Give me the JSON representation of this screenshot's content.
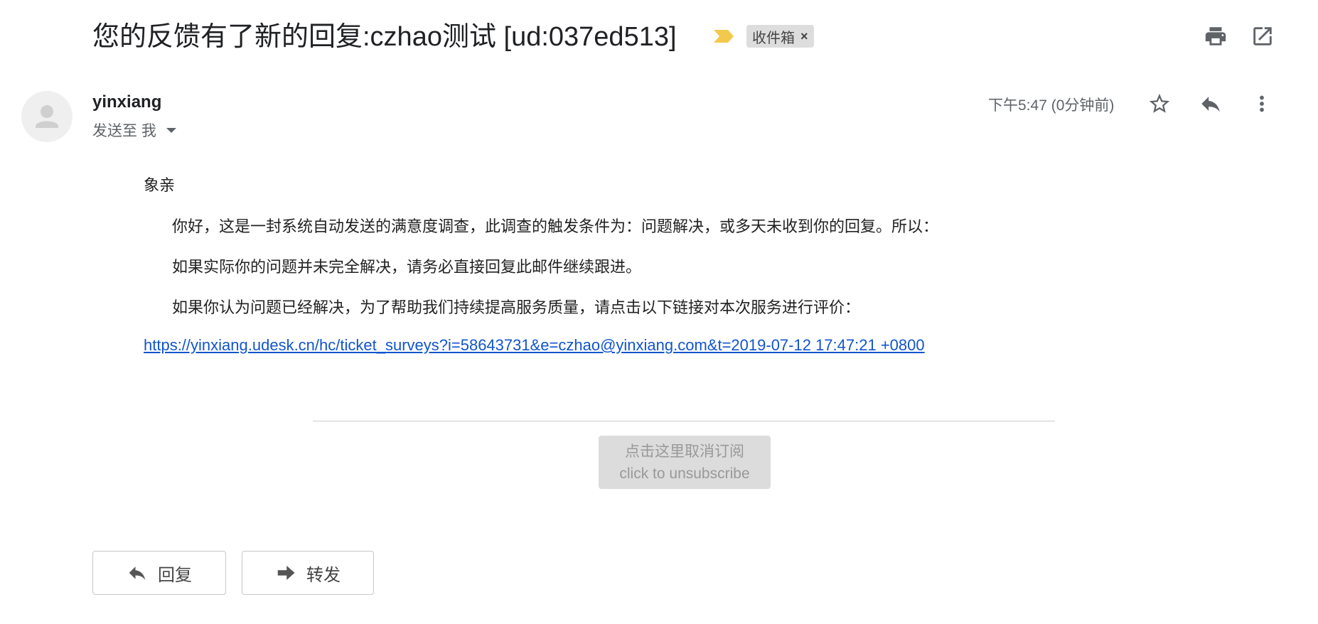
{
  "subject": {
    "title": "您的反馈有了新的回复:czhao测试 [ud:037ed513]",
    "label": "收件箱",
    "label_remove": "×"
  },
  "icons": {
    "importance": "importance-marker-icon",
    "print": "print-icon",
    "open_new_window": "open-in-new-window-icon",
    "avatar": "default-avatar-icon",
    "star": "star-icon",
    "reply": "reply-icon",
    "more": "more-vertical-icon",
    "forward": "forward-icon"
  },
  "colors": {
    "importance": "#f2c94c",
    "link": "#1155cc",
    "chip_bg": "#dddddd",
    "unsubscribe_bg": "#dcdcdc"
  },
  "message": {
    "sender": "yinxiang",
    "recipient": "发送至 我",
    "timestamp": "下午5:47 (0分钟前)",
    "greeting": "象亲",
    "paragraphs": [
      "你好，这是一封系统自动发送的满意度调查，此调查的触发条件为：问题解决，或多天未收到你的回复。所以：",
      "如果实际你的问题并未完全解决，请务必直接回复此邮件继续跟进。",
      "如果你认为问题已经解决，为了帮助我们持续提高服务质量，请点击以下链接对本次服务进行评价："
    ],
    "link": "https://yinxiang.udesk.cn/hc/ticket_surveys?i=58643731&e=czhao@yinxiang.com&t=2019-07-12 17:47:21 +0800",
    "unsubscribe_cn": "点击这里取消订阅",
    "unsubscribe_en": "click to unsubscribe"
  },
  "actions": {
    "reply": "回复",
    "forward": "转发"
  }
}
